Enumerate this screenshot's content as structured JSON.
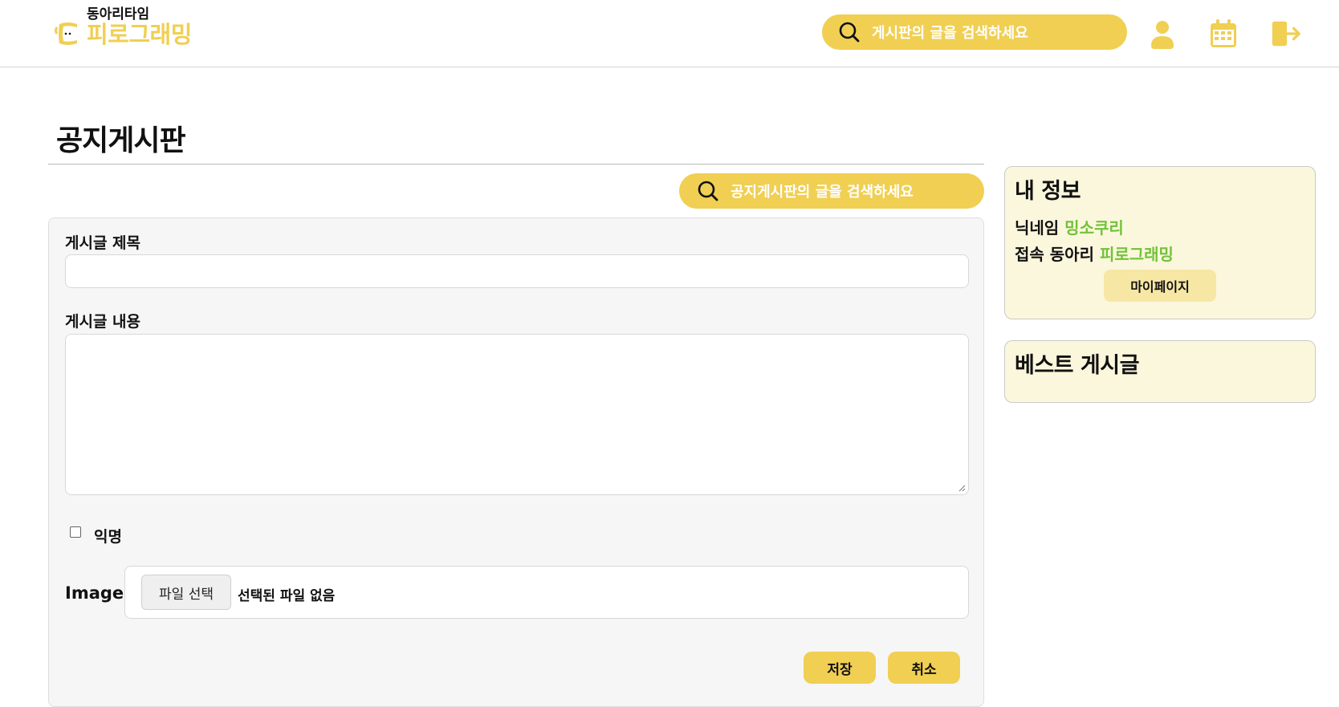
{
  "header": {
    "logo_small": "동아리타임",
    "logo_big": "피로그래밍",
    "search_placeholder": "게시판의 글을 검색하세요",
    "icons": [
      "user-icon",
      "calendar-icon",
      "logout-icon"
    ]
  },
  "page": {
    "title": "공지게시판",
    "board_search_placeholder": "공지게시판의 글을 검색하세요"
  },
  "form": {
    "title_label": "게시글 제목",
    "title_value": "",
    "content_label": "게시글 내용",
    "content_value": "",
    "anonymous_label": "익명",
    "anonymous_checked": false,
    "image_label": "Image",
    "file_button": "파일 선택",
    "file_status": "선택된 파일 없음",
    "save_label": "저장",
    "cancel_label": "취소"
  },
  "sidebar": {
    "my_info": {
      "title": "내 정보",
      "nickname_label": "닉네임",
      "nickname_value": "밍소쿠리",
      "club_label": "접속 동아리",
      "club_value": "피로그래밍",
      "mypage_label": "마이페이지"
    },
    "best_posts": {
      "title": "베스트 게시글"
    }
  },
  "colors": {
    "accent": "#f0cf52",
    "sidebar_bg": "#fbf7dc",
    "highlight_green": "#72c23a"
  }
}
